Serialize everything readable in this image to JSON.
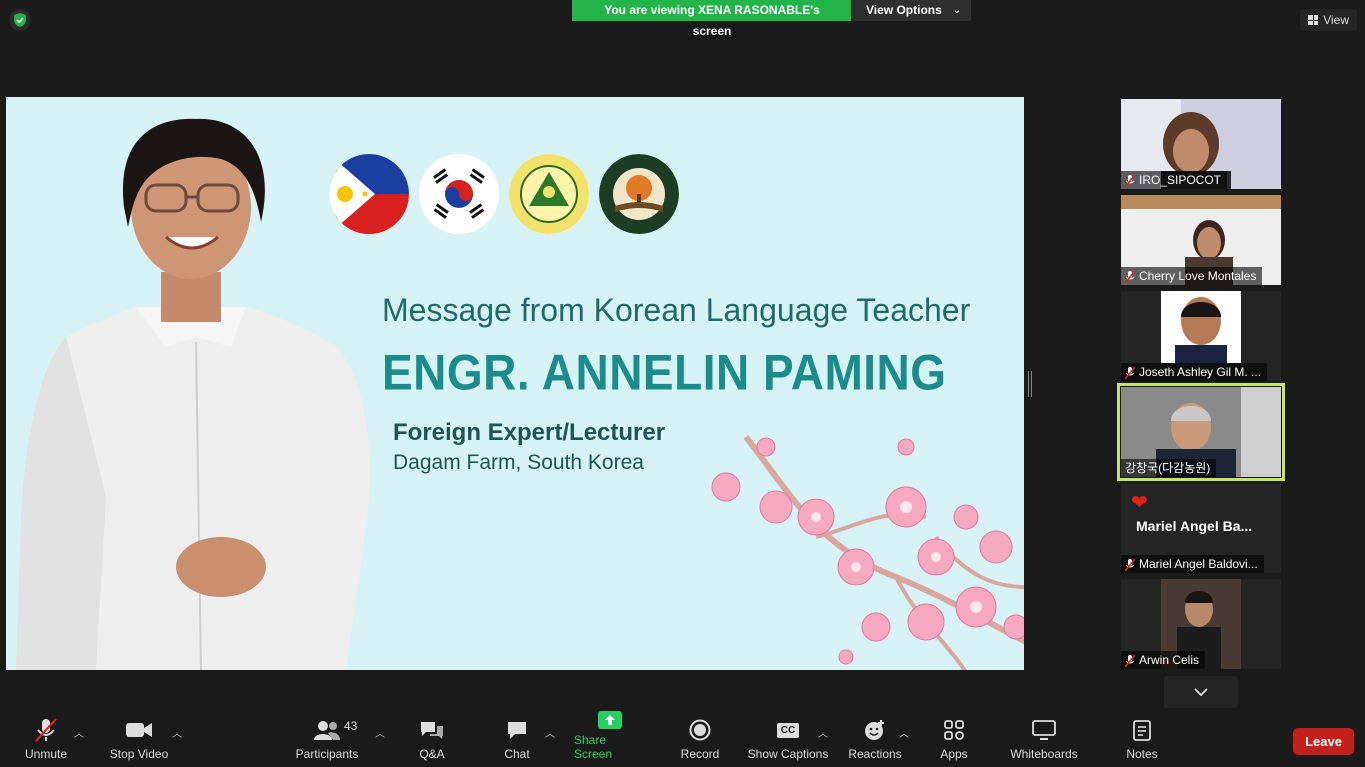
{
  "banner": {
    "viewing_text": "You are viewing XENA RASONABLE's screen",
    "view_options": "View Options"
  },
  "top_right": {
    "view_label": "View"
  },
  "slide": {
    "message_title": "Message from Korean Language Teacher",
    "name": "ENGR. ANNELIN PAMING",
    "role": "Foreign Expert/Lecturer",
    "organization": "Dagam Farm, South Korea",
    "logos": [
      "philippines-flag-icon",
      "korea-flag-icon",
      "university-seal",
      "dagam-farm-logo"
    ]
  },
  "participants_panel": {
    "tiles": [
      {
        "name": "IRO_SIPOCOT",
        "muted": true
      },
      {
        "name": "Cherry Love Montales",
        "muted": true
      },
      {
        "name": "Joseth Ashley Gil M. ...",
        "muted": true
      },
      {
        "name": "강창국(다감농원)",
        "muted": false,
        "active": true
      },
      {
        "name": "Mariel Angel Baldovi...",
        "big_name": "Mariel Angel Ba...",
        "muted": true
      },
      {
        "name": "Arwin Celis",
        "muted": true
      }
    ]
  },
  "toolbar": {
    "unmute": "Unmute",
    "stop_video": "Stop Video",
    "participants": "Participants",
    "participants_count": "43",
    "qa": "Q&A",
    "chat": "Chat",
    "share_screen": "Share Screen",
    "record": "Record",
    "show_captions": "Show Captions",
    "cc": "CC",
    "reactions": "Reactions",
    "apps": "Apps",
    "whiteboards": "Whiteboards",
    "notes": "Notes",
    "leave": "Leave"
  },
  "colors": {
    "accent_green": "#23b449",
    "leave_red": "#c4201b",
    "active_speaker": "#c8e562",
    "slide_bg": "#d8f3f6"
  }
}
